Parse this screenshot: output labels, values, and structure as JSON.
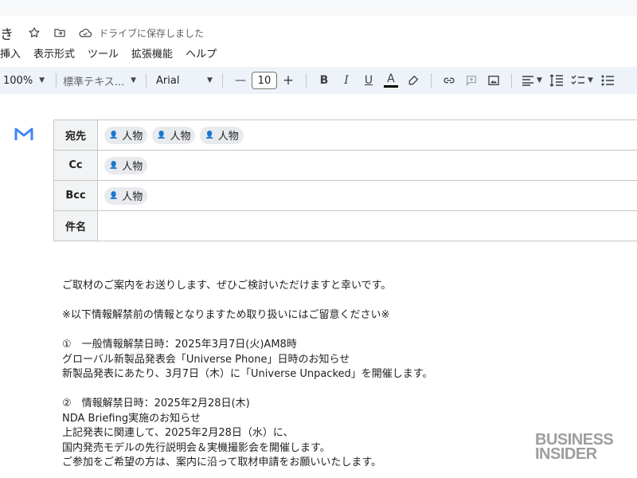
{
  "doc": {
    "title_fragment": "き",
    "saved_status": "ドライブに保存しました",
    "icons": [
      "star-icon",
      "move-folder-icon",
      "cloud-saved-icon"
    ]
  },
  "menu": [
    "挿入",
    "表示形式",
    "ツール",
    "拡張機能",
    "ヘルプ"
  ],
  "toolbar": {
    "zoom": "100%",
    "style": "標準テキス...",
    "font": "Arial",
    "font_size": "10",
    "minus": "—",
    "plus": "+",
    "bold": "B",
    "italic": "I",
    "underline": "U",
    "text_color": "A"
  },
  "email": {
    "to_label": "宛先",
    "cc_label": "Cc",
    "bcc_label": "Bcc",
    "subject_label": "件名",
    "to_chips": [
      "人物",
      "人物",
      "人物"
    ],
    "cc_chips": [
      "人物"
    ],
    "bcc_chips": [
      "人物"
    ],
    "subject": ""
  },
  "body_lines": [
    "ご取材のご案内をお送りします、ぜひご検討いただけますと幸いです。",
    "",
    "※以下情報解禁前の情報となりますため取り扱いにはご留意ください※",
    "",
    "①　一般情報解禁日時：2025年3月7日(火)AM8時",
    "グローバル新製品発表会「Universe Phone」日時のお知らせ",
    "新製品発表にあたり、3月7日（木）に「Universe Unpacked」を開催します。",
    "",
    "②　情報解禁日時：2025年2月28日(木)",
    "NDA Briefing実施のお知らせ",
    "上記発表に関連して、2025年2月28日（水）に、",
    "国内発売モデルの先行説明会＆実機撮影会を開催します。",
    "ご参加をご希望の方は、案内に沿って取材申請をお願いいたします。"
  ],
  "watermark": {
    "line1": "BUSINESS",
    "line2": "INSIDER"
  },
  "colors": {
    "toolbar_bg": "#eef2f9",
    "label_bg": "#f1f3f4",
    "chip_bg": "#e8eaed",
    "gmail_blue": "#4285f4"
  }
}
